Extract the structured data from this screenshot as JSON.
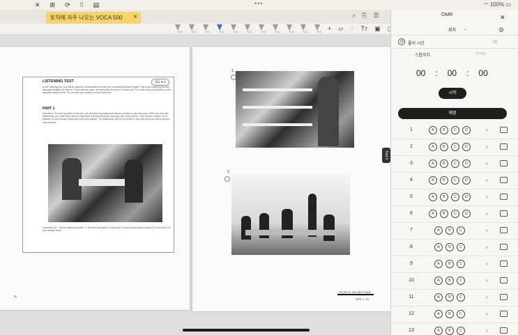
{
  "status": {
    "battery": "100%"
  },
  "tabs": {
    "active_title": "토익에 자주 나오는 VOCA 500",
    "close_glyph": "×"
  },
  "toolbar": {
    "pens": [
      {
        "level": "0.3",
        "color": "#9a9a9a"
      },
      {
        "level": "0.3",
        "color": "#9a9a9a"
      },
      {
        "level": "0.5",
        "color": "#9a9a9a"
      },
      {
        "level": "0.3",
        "color": "#3a6fd8"
      },
      {
        "level": "0.3",
        "color": "#9a9a9a"
      },
      {
        "level": "0.3",
        "color": "#9a9a9a"
      },
      {
        "level": "0.3",
        "color": "#9a9a9a"
      },
      {
        "level": "0.3",
        "color": "#9a9a9a"
      },
      {
        "level": "0.3",
        "color": "#9a9a9a"
      },
      {
        "level": "0.3",
        "color": "#9a9a9a"
      },
      {
        "level": "0.3",
        "color": "#9a9a9a"
      }
    ]
  },
  "document": {
    "listening_title": "LISTENING TEST",
    "answer_button": "정답 보기",
    "intro_text": "In the Listening test, you will be asked to demonstrate how well you understand spoken English. The entire Listening test will last approximately 45 minutes. There are four parts, and directions are given for each part. You must mark your answers on the separate answer sheet. Do not write your answers in your test book.",
    "part_label": "PART 1",
    "directions_text": "Directions: For each question in this part, you will hear four statements about a picture in your test book. When you hear the statements, you must select the one statement that best describes what you see in the picture. Then find the number of the question on your answer sheet and mark your answer. The statements will not be printed in your test book and will be spoken only one time.",
    "statement_text": "Statement (C), \"They're sitting at a table,\" is the best description of the picture, so you should select answer (C) and mark it on your answer sheet.",
    "q1_number": "1.",
    "q2_number": "2.",
    "go_next": "GO ON TO THE NEXT PAGE",
    "right_page_number": "TEST 2 · 33",
    "left_page_number": "32",
    "side_tab": "Test 2"
  },
  "omr": {
    "title": "OMR",
    "subtitle": "회차",
    "timer_label": "풀이 시간",
    "stopwatch_tab": "스톱워치",
    "timer_tab": "타이머",
    "extra_label": "00",
    "timer": {
      "hh": "00",
      "sep1": ":",
      "mm": "00",
      "sep2": ":",
      "ss": "00"
    },
    "start_button": "시작",
    "grade_button": "채점",
    "rows": [
      {
        "num": "1",
        "choices": [
          "A",
          "B",
          "C",
          "D"
        ]
      },
      {
        "num": "2",
        "choices": [
          "A",
          "B",
          "C",
          "D"
        ]
      },
      {
        "num": "3",
        "choices": [
          "A",
          "B",
          "C",
          "D"
        ]
      },
      {
        "num": "4",
        "choices": [
          "A",
          "B",
          "C",
          "D"
        ]
      },
      {
        "num": "5",
        "choices": [
          "A",
          "B",
          "C",
          "D"
        ]
      },
      {
        "num": "6",
        "choices": [
          "A",
          "B",
          "C",
          "D"
        ]
      },
      {
        "num": "7",
        "choices": [
          "A",
          "B",
          "C"
        ]
      },
      {
        "num": "8",
        "choices": [
          "A",
          "B",
          "C"
        ]
      },
      {
        "num": "9",
        "choices": [
          "A",
          "B",
          "C"
        ]
      },
      {
        "num": "10",
        "choices": [
          "A",
          "B",
          "C"
        ]
      },
      {
        "num": "11",
        "choices": [
          "A",
          "B",
          "C"
        ]
      },
      {
        "num": "12",
        "choices": [
          "A",
          "B",
          "C"
        ]
      },
      {
        "num": "13",
        "choices": [
          "A",
          "B",
          "C"
        ]
      }
    ]
  }
}
